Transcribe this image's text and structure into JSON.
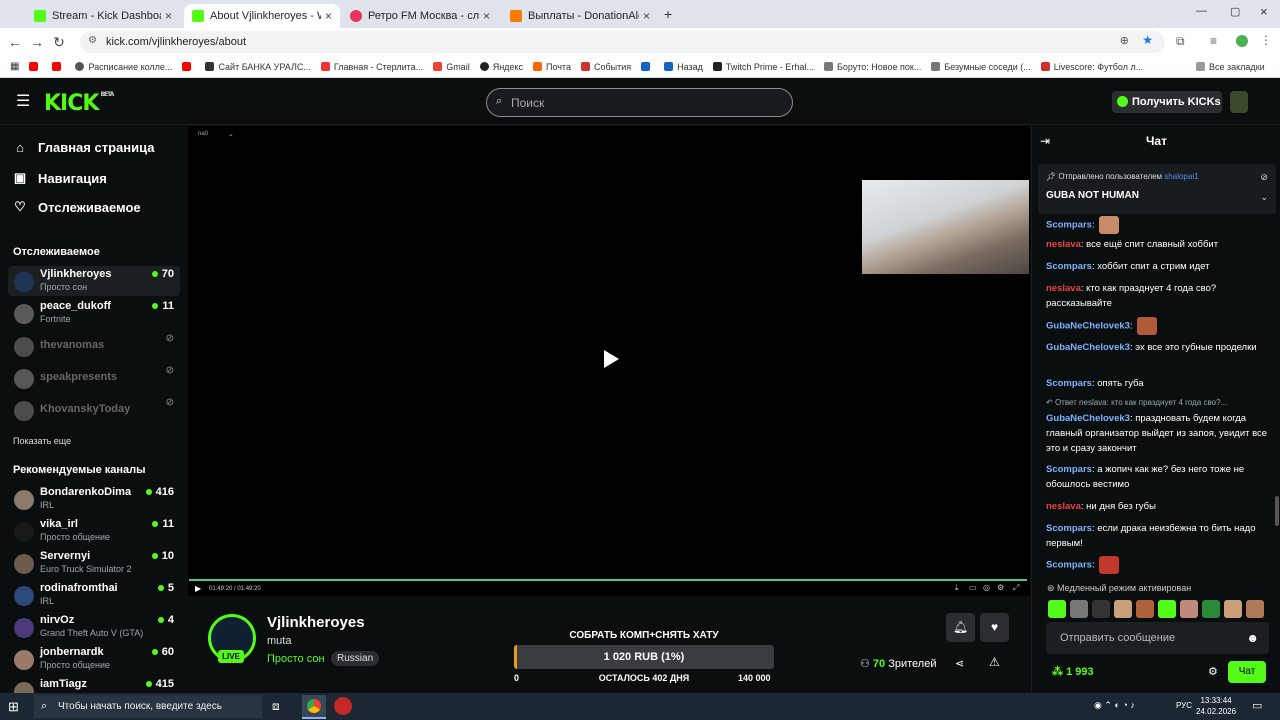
{
  "browser": {
    "tabs": [
      {
        "title": "Stream - Kick Dashboard",
        "color": "#53fc18",
        "active": false
      },
      {
        "title": "About Vjlinkheroyes - Watc",
        "color": "#53fc18",
        "active": true
      },
      {
        "title": "Ретро FM Москва - слуша",
        "color": "#e8335a",
        "active": false
      },
      {
        "title": "Выплаты - DonationAlerts",
        "color": "#f57c00",
        "active": false
      }
    ],
    "url": "kick.com/vjlinkheroyes/about",
    "bookmarks": [
      "Расписание колле...",
      "Сайт БАНКА УРАЛС...",
      "Главная - Стерлита...",
      "Gmail",
      "Яндекс",
      "Почта",
      "События",
      "Назад",
      "Twitch Prime - Erhal...",
      "Боруто: Новое пок...",
      "Безумные соседи (...",
      "Livescore: Футбол л...",
      "Все закладки"
    ]
  },
  "kick": {
    "logo": "KICK",
    "logo_badge": "BETA",
    "search_placeholder": "Поиск",
    "get_kicks": "Получить KICKs"
  },
  "sidebar": {
    "nav": [
      "Главная страница",
      "Навигация",
      "Отслеживаемое"
    ],
    "following_title": "Отслеживаемое",
    "following": [
      {
        "name": "Vjlinkheroyes",
        "sub": "Просто сон",
        "viewers": "70",
        "online": true
      },
      {
        "name": "peace_dukoff",
        "sub": "Fortnite",
        "viewers": "11",
        "online": true
      },
      {
        "name": "thevanomas",
        "sub": "",
        "viewers": "",
        "online": false
      },
      {
        "name": "speakpresents",
        "sub": "",
        "viewers": "",
        "online": false
      },
      {
        "name": "KhovanskyToday",
        "sub": "",
        "viewers": "",
        "online": false
      }
    ],
    "show_more": "Показать еще",
    "recommended_title": "Рекомендуемые каналы",
    "recommended": [
      {
        "name": "BondarenkoDima",
        "sub": "IRL",
        "viewers": "416"
      },
      {
        "name": "vika_irl",
        "sub": "Просто общение",
        "viewers": "11"
      },
      {
        "name": "Servernyi",
        "sub": "Euro Truck Simulator 2",
        "viewers": "10"
      },
      {
        "name": "rodinafromthai",
        "sub": "IRL",
        "viewers": "5"
      },
      {
        "name": "nirvOz",
        "sub": "Grand Theft Auto V (GTA)",
        "viewers": "4"
      },
      {
        "name": "jonbernardk",
        "sub": "Просто общение",
        "viewers": "60"
      },
      {
        "name": "iamTiagz",
        "sub": "",
        "viewers": "415"
      }
    ]
  },
  "player": {
    "time": "01:49:20 / 01:49:20",
    "quality": "na0"
  },
  "stream": {
    "name": "Vjlinkheroyes",
    "title": "muta",
    "category": "Просто сон",
    "language": "Russian",
    "live": "LIVE",
    "goal_title": "СОБРАТЬ КОМП+СНЯТЬ ХАТУ",
    "goal_amount": "1 020 RUB (1%)",
    "goal_progress": 0.01,
    "goal_min": "0",
    "goal_left": "ОСТАЛОСЬ 402 ДНЯ",
    "goal_max": "140 000",
    "viewers_count": "70",
    "viewers_label": "Зрителей"
  },
  "chat": {
    "title": "Чат",
    "pinned_by_label": "Отправлено пользователем",
    "pinned_user": "shalopai1",
    "pinned_message": "GUBA NOT HUMAN",
    "messages": [
      {
        "user": "Scompars",
        "text": "",
        "color": "blue",
        "emote": "#c98a6a"
      },
      {
        "user": "neslava",
        "text": "все ещё спит славный хоббит",
        "color": "red"
      },
      {
        "user": "Scompars",
        "text": "хоббит спит а стрим идет",
        "color": "blue"
      },
      {
        "user": "neslava",
        "text": "кто как празднует 4 года сво? рассказывайте",
        "color": "red"
      },
      {
        "user": "GubaNeChelovek3",
        "text": "",
        "color": "blue",
        "emote": "#b05a3a"
      },
      {
        "user": "GubaNeChelovek3",
        "text": "эх все это губные проделки",
        "color": "blue"
      },
      {
        "user": "Scompars",
        "text": "опять губа",
        "color": "blue"
      },
      {
        "user": "GubaNeChelovek3",
        "text": "праздновать будем когда главный организатор выйдет из запоя, увидит все это и сразу закончит",
        "color": "blue"
      },
      {
        "user": "Scompars",
        "text": "а жопич как же? без него тоже не обошлось вестимо",
        "color": "blue"
      },
      {
        "user": "neslava",
        "text": "ни дня без губы",
        "color": "red"
      },
      {
        "user": "Scompars",
        "text": "если драка неизбежна то бить надо первым!",
        "color": "blue"
      },
      {
        "user": "Scompars",
        "text": "",
        "color": "blue",
        "emote": "#c0392b"
      }
    ],
    "reply_label": "Ответ neslava: кто как празднует 4 года сво?...",
    "slow_mode": "Медленный режим активирован",
    "input_placeholder": "Отправить сообщение",
    "points": "1 993",
    "send_label": "Чат"
  },
  "taskbar": {
    "search_placeholder": "Чтобы начать поиск, введите здесь",
    "lang": "РУС",
    "time": "13:33:44",
    "date": "24.02.2026"
  }
}
